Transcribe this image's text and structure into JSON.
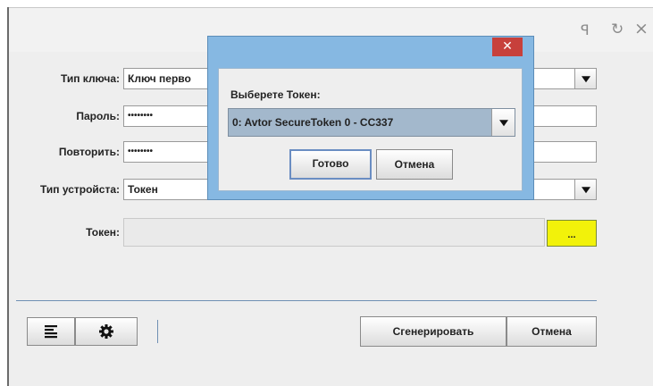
{
  "window": {
    "pin_icon": "pin-icon",
    "refresh_icon": "refresh-icon",
    "close_icon": "close-icon",
    "pin_glyph": "ꟼ",
    "refresh_glyph": "↻",
    "close_glyph": "×"
  },
  "form": {
    "key_type_label": "Тип ключа:",
    "key_type_value": "Ключ перво",
    "password_label": "Пароль:",
    "password_value": "••••••••",
    "repeat_label": "Повторить:",
    "repeat_value": "••••••••",
    "device_type_label": "Тип устройста:",
    "device_type_value": "Токен",
    "token_label": "Токен:",
    "token_value": "",
    "browse_label": "..."
  },
  "bottom": {
    "list_icon": "list-icon",
    "settings_icon": "gear-icon",
    "generate_label": "Сгенерировать",
    "cancel_label": "Отмена"
  },
  "dialog": {
    "close_glyph": "✕",
    "prompt": "Выберете Токен:",
    "selected_token": "0: Avtor SecureToken 0 - CC337",
    "ok_label": "Готово",
    "cancel_label": "Отмена"
  },
  "colors": {
    "dialog_frame": "#86b8e2",
    "dialog_close": "#c7403b",
    "browse_highlight": "#f2f20a",
    "selected_combo": "#a3b8cc"
  }
}
